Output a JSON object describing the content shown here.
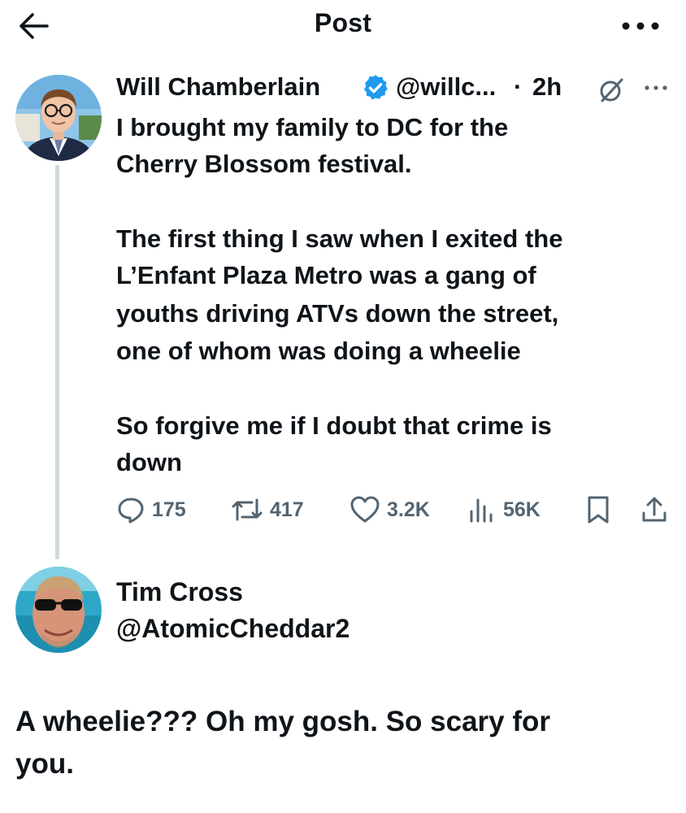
{
  "header": {
    "title": "Post"
  },
  "icons": {
    "back": "arrow-left-icon",
    "more": "more-horizontal-icon",
    "verified": "verified-badge-icon",
    "grok": "grok-icon",
    "reply": "reply-icon",
    "retweet": "retweet-icon",
    "like": "heart-icon",
    "views": "views-icon",
    "bookmark": "bookmark-icon",
    "share": "share-icon"
  },
  "colors": {
    "verified": "#1d9bf0",
    "text": "#0f1419",
    "icons": "#536471",
    "thread_line": "#cfd9de"
  },
  "tweet": {
    "author_name": "Will Chamberlain",
    "handle": "@willc...",
    "separator": "·",
    "time": "2h",
    "text_lines": [
      "I brought my family to DC for the",
      "Cherry Blossom festival.",
      "The first thing I saw when I exited the",
      "L’Enfant Plaza Metro was a gang of",
      "youths driving ATVs down the street,",
      "one of whom was doing a wheelie",
      "So forgive me if I doubt that crime is",
      "down"
    ],
    "stats": {
      "replies": "175",
      "retweets": "417",
      "likes": "3.2K",
      "views": "56K"
    }
  },
  "reply": {
    "author_name": "Tim Cross",
    "handle": "@AtomicCheddar2",
    "text_lines": [
      "A wheelie??? Oh my gosh.  So scary for",
      "you."
    ]
  }
}
